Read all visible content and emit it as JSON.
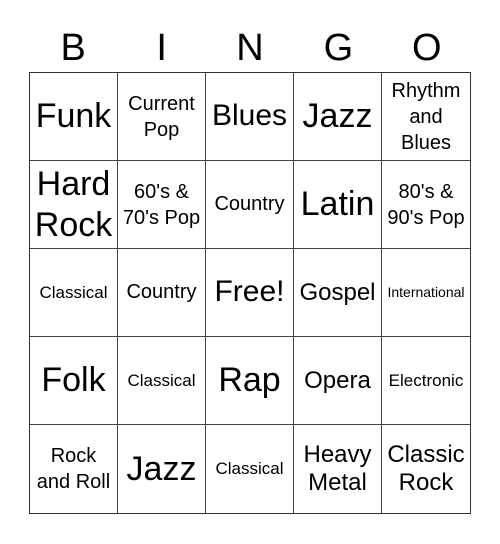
{
  "header": {
    "letters": [
      "B",
      "I",
      "N",
      "G",
      "O"
    ]
  },
  "grid": {
    "rows": [
      [
        {
          "text": "Funk",
          "size": "xl"
        },
        {
          "text": "Current Pop",
          "size": "sm"
        },
        {
          "text": "Blues",
          "size": "l"
        },
        {
          "text": "Jazz",
          "size": "xl"
        },
        {
          "text": "Rhythm and Blues",
          "size": "sm"
        }
      ],
      [
        {
          "text": "Hard Rock",
          "size": "xl"
        },
        {
          "text": "60's & 70's Pop",
          "size": "sm"
        },
        {
          "text": "Country",
          "size": "s"
        },
        {
          "text": "Latin",
          "size": "xl"
        },
        {
          "text": "80's & 90's Pop",
          "size": "sm"
        }
      ],
      [
        {
          "text": "Classical",
          "size": "xs"
        },
        {
          "text": "Country",
          "size": "s"
        },
        {
          "text": "Free!",
          "size": "l"
        },
        {
          "text": "Gospel",
          "size": "m"
        },
        {
          "text": "International",
          "size": "xxs"
        }
      ],
      [
        {
          "text": "Folk",
          "size": "xl"
        },
        {
          "text": "Classical",
          "size": "xs"
        },
        {
          "text": "Rap",
          "size": "xl"
        },
        {
          "text": "Opera",
          "size": "m"
        },
        {
          "text": "Electronic",
          "size": "xs"
        }
      ],
      [
        {
          "text": "Rock and Roll",
          "size": "sm"
        },
        {
          "text": "Jazz",
          "size": "xl"
        },
        {
          "text": "Classical",
          "size": "xs"
        },
        {
          "text": "Heavy Metal",
          "size": "m"
        },
        {
          "text": "Classic Rock",
          "size": "m"
        }
      ]
    ]
  }
}
